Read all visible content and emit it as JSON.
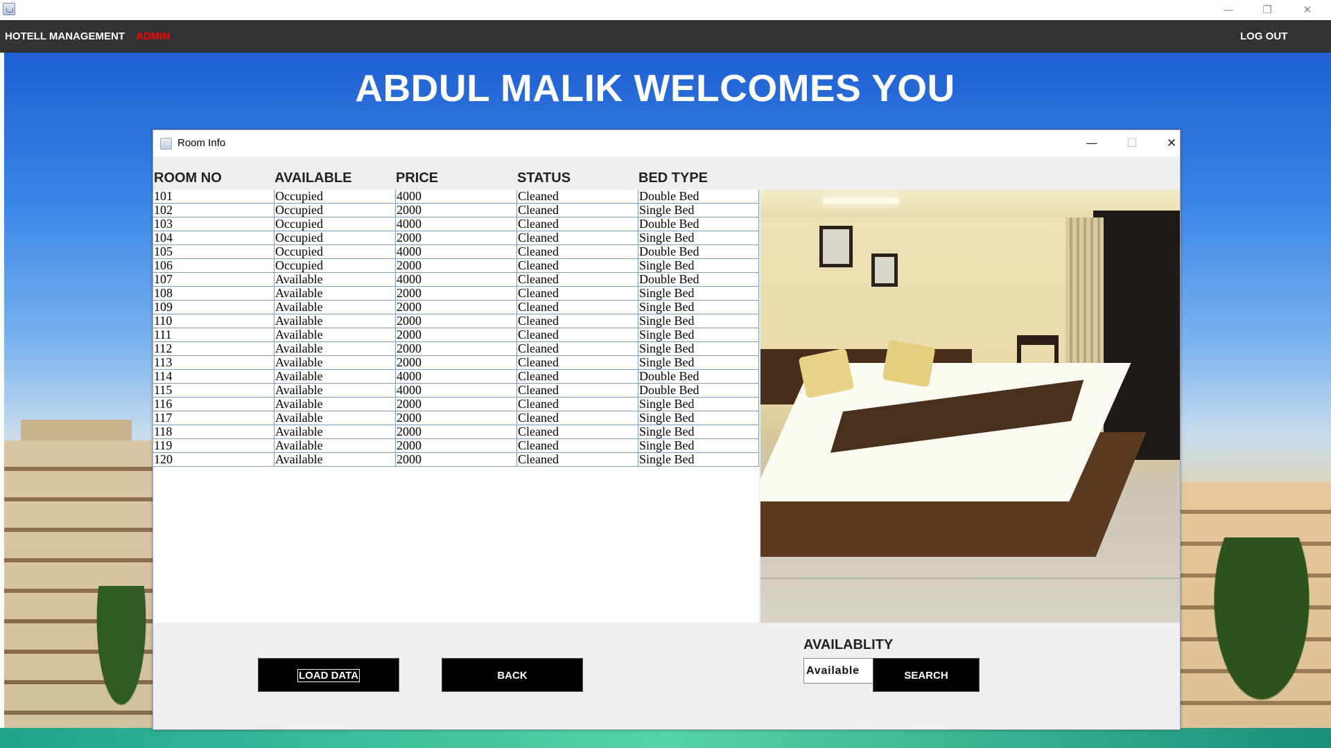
{
  "window": {
    "minimize_glyph": "—",
    "restore_glyph": "❐",
    "close_glyph": "✕"
  },
  "menubar": {
    "title": "HOTELL MANAGEMENT",
    "role": "ADMIN",
    "logout_label": "LOG OUT"
  },
  "welcome": "ABDUL MALIK WELCOMES YOU",
  "dialog": {
    "title": "Room Info",
    "minimize_glyph": "—",
    "maximize_glyph": "☐",
    "close_glyph": "✕"
  },
  "table": {
    "headers": [
      "ROOM NO",
      "AVAILABLE",
      "PRICE",
      "STATUS",
      "BED TYPE"
    ],
    "rows": [
      [
        "101",
        "Occupied",
        "4000",
        "Cleaned",
        "Double Bed"
      ],
      [
        "102",
        "Occupied",
        "2000",
        "Cleaned",
        "Single Bed"
      ],
      [
        "103",
        "Occupied",
        "4000",
        "Cleaned",
        "Double Bed"
      ],
      [
        "104",
        "Occupied",
        "2000",
        "Cleaned",
        "Single Bed"
      ],
      [
        "105",
        "Occupied",
        "4000",
        "Cleaned",
        "Double Bed"
      ],
      [
        "106",
        "Occupied",
        "2000",
        "Cleaned",
        "Single Bed"
      ],
      [
        "107",
        "Available",
        "4000",
        "Cleaned",
        "Double Bed"
      ],
      [
        "108",
        "Available",
        "2000",
        "Cleaned",
        "Single Bed"
      ],
      [
        "109",
        "Available",
        "2000",
        "Cleaned",
        "Single Bed"
      ],
      [
        "110",
        "Available",
        "2000",
        "Cleaned",
        "Single Bed"
      ],
      [
        "111",
        "Available",
        "2000",
        "Cleaned",
        "Single Bed"
      ],
      [
        "112",
        "Available",
        "2000",
        "Cleaned",
        "Single Bed"
      ],
      [
        "113",
        "Available",
        "2000",
        "Cleaned",
        "Single Bed"
      ],
      [
        "114",
        "Available",
        "4000",
        "Cleaned",
        "Double Bed"
      ],
      [
        "115",
        "Available",
        "4000",
        "Cleaned",
        "Double Bed"
      ],
      [
        "116",
        "Available",
        "2000",
        "Cleaned",
        "Single Bed"
      ],
      [
        "117",
        "Available",
        "2000",
        "Cleaned",
        "Single Bed"
      ],
      [
        "118",
        "Available",
        "2000",
        "Cleaned",
        "Single Bed"
      ],
      [
        "119",
        "Available",
        "2000",
        "Cleaned",
        "Single Bed"
      ],
      [
        "120",
        "Available",
        "2000",
        "Cleaned",
        "Single Bed"
      ]
    ]
  },
  "controls": {
    "load_label": "LOAD DATA",
    "back_label": "BACK",
    "availability_label": "AVAILABLITY",
    "availability_value": "Available",
    "search_label": "SEARCH"
  },
  "colors": {
    "menubar": "#333333",
    "admin": "#ff0000",
    "grid_line": "#7a9cc6",
    "button": "#000000"
  }
}
